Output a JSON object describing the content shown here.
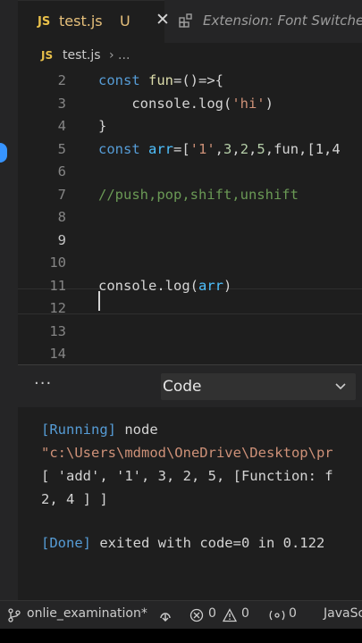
{
  "tabs": {
    "active": {
      "badge": "JS",
      "name": "test.js",
      "modified": "U",
      "close": "✕"
    },
    "other": {
      "name": "Extension: Font Switcher"
    }
  },
  "breadcrumb": {
    "badge": "JS",
    "file": "test.js",
    "separator": "› ..."
  },
  "editor": {
    "lines": [
      {
        "num": "2",
        "tokens": [
          [
            "kw",
            "const "
          ],
          [
            "fn",
            "fun"
          ],
          [
            "pun",
            "=()=>{"
          ]
        ]
      },
      {
        "num": "3",
        "tokens": [
          [
            "pun",
            "    console.log("
          ],
          [
            "str",
            "'hi'"
          ],
          [
            "pun",
            ")"
          ]
        ]
      },
      {
        "num": "4",
        "tokens": [
          [
            "pun",
            "}"
          ]
        ]
      },
      {
        "num": "5",
        "tokens": [
          [
            "kw",
            "const "
          ],
          [
            "var",
            "arr"
          ],
          [
            "pun",
            "=["
          ],
          [
            "str",
            "'1'"
          ],
          [
            "pun",
            ","
          ],
          [
            "num",
            "3"
          ],
          [
            "pun",
            ","
          ],
          [
            "num",
            "2"
          ],
          [
            "pun",
            ","
          ],
          [
            "num",
            "5"
          ],
          [
            "pun",
            ",fun,[1,4"
          ]
        ]
      },
      {
        "num": "6",
        "tokens": []
      },
      {
        "num": "7",
        "tokens": [
          [
            "cmt",
            "//push,pop,shift,unshift"
          ]
        ]
      },
      {
        "num": "8",
        "tokens": []
      },
      {
        "num": "9",
        "tokens": []
      },
      {
        "num": "10",
        "tokens": []
      },
      {
        "num": "11",
        "tokens": [
          [
            "pun",
            "console.log("
          ],
          [
            "var",
            "arr"
          ],
          [
            "pun",
            ")"
          ]
        ]
      },
      {
        "num": "12",
        "tokens": []
      },
      {
        "num": "13",
        "tokens": []
      },
      {
        "num": "14",
        "tokens": []
      }
    ],
    "current_line": "9"
  },
  "panel": {
    "more": "···",
    "selected": "Code"
  },
  "output": {
    "running_tag": "[Running]",
    "running_cmd": " node",
    "path": "\"c:\\Users\\mdmod\\OneDrive\\Desktop\\pr",
    "result1": "[ 'add', '1', 3, 2, 5, [Function: f",
    "result2": "2, 4 ] ]",
    "done_tag": "[Done]",
    "done_text": " exited with code=0 in 0.122"
  },
  "status": {
    "branch": "onlie_examination*",
    "errors": "0",
    "warnings": "0",
    "ports": "0",
    "language": "JavaSc"
  },
  "colors": {
    "accent": "#3794ff",
    "js_badge": "#e8c04a",
    "tab_modified": "#e6c07b"
  }
}
